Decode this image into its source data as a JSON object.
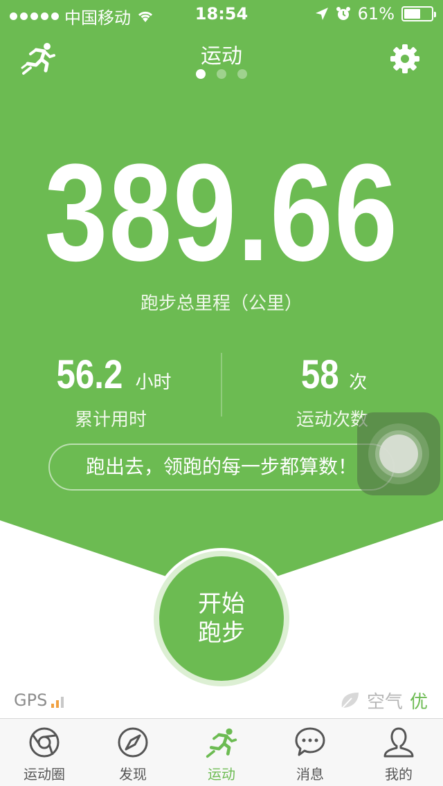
{
  "status_bar": {
    "carrier": "中国移动",
    "time": "18:54",
    "battery": "61%",
    "battery_level": 0.61
  },
  "nav": {
    "title": "运动",
    "page_count": 3,
    "active_page": 0
  },
  "hero": {
    "total_distance": "389.66",
    "total_distance_label": "跑步总里程（公里）"
  },
  "stats": {
    "duration": {
      "value": "56.2",
      "unit": "小时",
      "label": "累计用时"
    },
    "sessions": {
      "value": "58",
      "unit": "次",
      "label": "运动次数"
    }
  },
  "slogan": "跑出去，领跑的每一步都算数！",
  "start_button": {
    "line1": "开始",
    "line2": "跑步"
  },
  "gps": {
    "label": "GPS"
  },
  "air": {
    "label": "空气",
    "quality": "优"
  },
  "tabs": [
    {
      "label": "运动圈",
      "icon": "circle-lens-icon",
      "active": false
    },
    {
      "label": "发现",
      "icon": "compass-icon",
      "active": false
    },
    {
      "label": "运动",
      "icon": "runner-icon",
      "active": true
    },
    {
      "label": "消息",
      "icon": "chat-bubble-icon",
      "active": false
    },
    {
      "label": "我的",
      "icon": "person-icon",
      "active": false
    }
  ],
  "colors": {
    "brand_green": "#6cbb52",
    "tab_inactive": "#555555",
    "gps_orange": "#f0a040"
  }
}
